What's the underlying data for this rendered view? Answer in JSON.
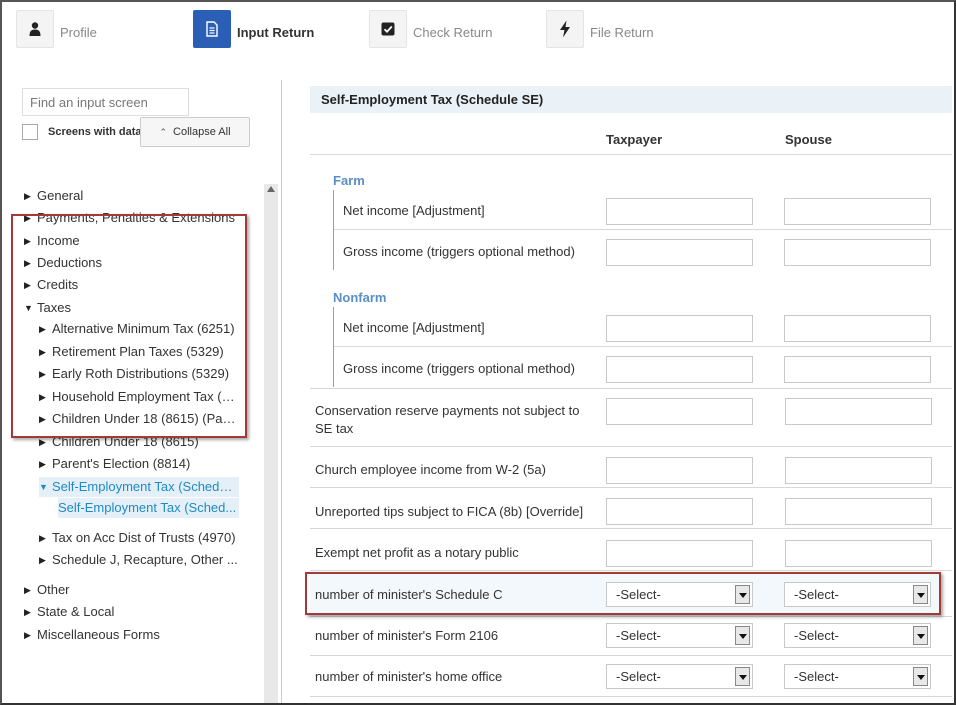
{
  "steps": [
    {
      "label": "Profile",
      "icon": "person-icon",
      "active": false
    },
    {
      "label": "Input Return",
      "icon": "document-icon",
      "active": true
    },
    {
      "label": "Check Return",
      "icon": "checkbox-icon",
      "active": false
    },
    {
      "label": "File Return",
      "icon": "lightning-icon",
      "active": false
    }
  ],
  "sidebar": {
    "search_placeholder": "Find an input screen",
    "screens_with_data_label": "Screens with data",
    "collapse_all_label": "Collapse All",
    "tree": [
      {
        "label": "General",
        "expanded": false,
        "level": 0
      },
      {
        "label": "Payments, Penalties & Extensions",
        "expanded": false,
        "level": 0
      },
      {
        "label": "Income",
        "expanded": false,
        "level": 0
      },
      {
        "label": "Deductions",
        "expanded": false,
        "level": 0
      },
      {
        "label": "Credits",
        "expanded": false,
        "level": 0
      },
      {
        "label": "Taxes",
        "expanded": true,
        "level": 0
      },
      {
        "label": "Alternative Minimum Tax (6251)",
        "expanded": false,
        "level": 1
      },
      {
        "label": "Retirement Plan Taxes (5329)",
        "expanded": false,
        "level": 1
      },
      {
        "label": "Early Roth Distributions (5329)",
        "expanded": false,
        "level": 1
      },
      {
        "label": "Household Employment Tax (S...",
        "expanded": false,
        "level": 1
      },
      {
        "label": "Children Under 18 (8615) (Pare...",
        "expanded": false,
        "level": 1
      },
      {
        "label": "Children Under 18 (8615)",
        "expanded": false,
        "level": 1
      },
      {
        "label": "Parent's Election (8814)",
        "expanded": false,
        "level": 1
      },
      {
        "label": "Self-Employment Tax (Schedul...",
        "expanded": true,
        "level": 1,
        "selected": true
      },
      {
        "label": "Self-Employment Tax (Sched...",
        "level": 2,
        "selected": true,
        "leaf": true
      },
      {
        "label": "Tax on Acc Dist of Trusts (4970)",
        "expanded": false,
        "level": 1
      },
      {
        "label": "Schedule J, Recapture, Other ...",
        "expanded": false,
        "level": 1
      },
      {
        "label": "Other",
        "expanded": false,
        "level": 0
      },
      {
        "label": "State & Local",
        "expanded": false,
        "level": 0
      },
      {
        "label": "Miscellaneous Forms",
        "expanded": false,
        "level": 0
      }
    ]
  },
  "form": {
    "title": "Self-Employment Tax (Schedule SE)",
    "col_taxpayer": "Taxpayer",
    "col_spouse": "Spouse",
    "farm_title": "Farm",
    "nonfarm_title": "Nonfarm",
    "rows": {
      "farm_net": "Net income [Adjustment]",
      "farm_gross": "Gross income (triggers optional method)",
      "nonfarm_net": "Net income [Adjustment]",
      "nonfarm_gross": "Gross income (triggers optional method)",
      "crp_line1": "Conservation reserve payments not subject to",
      "crp_line2": "SE tax",
      "church": "Church employee income from W-2 (5a)",
      "tips": "Unreported tips subject to FICA (8b) [Override]",
      "notary": "Exempt net profit as a notary public",
      "min_sch_c": "number of minister's Schedule C",
      "min_2106": "number of minister's Form 2106",
      "min_home": "number of minister's home office"
    },
    "select_placeholder": "-Select-"
  }
}
